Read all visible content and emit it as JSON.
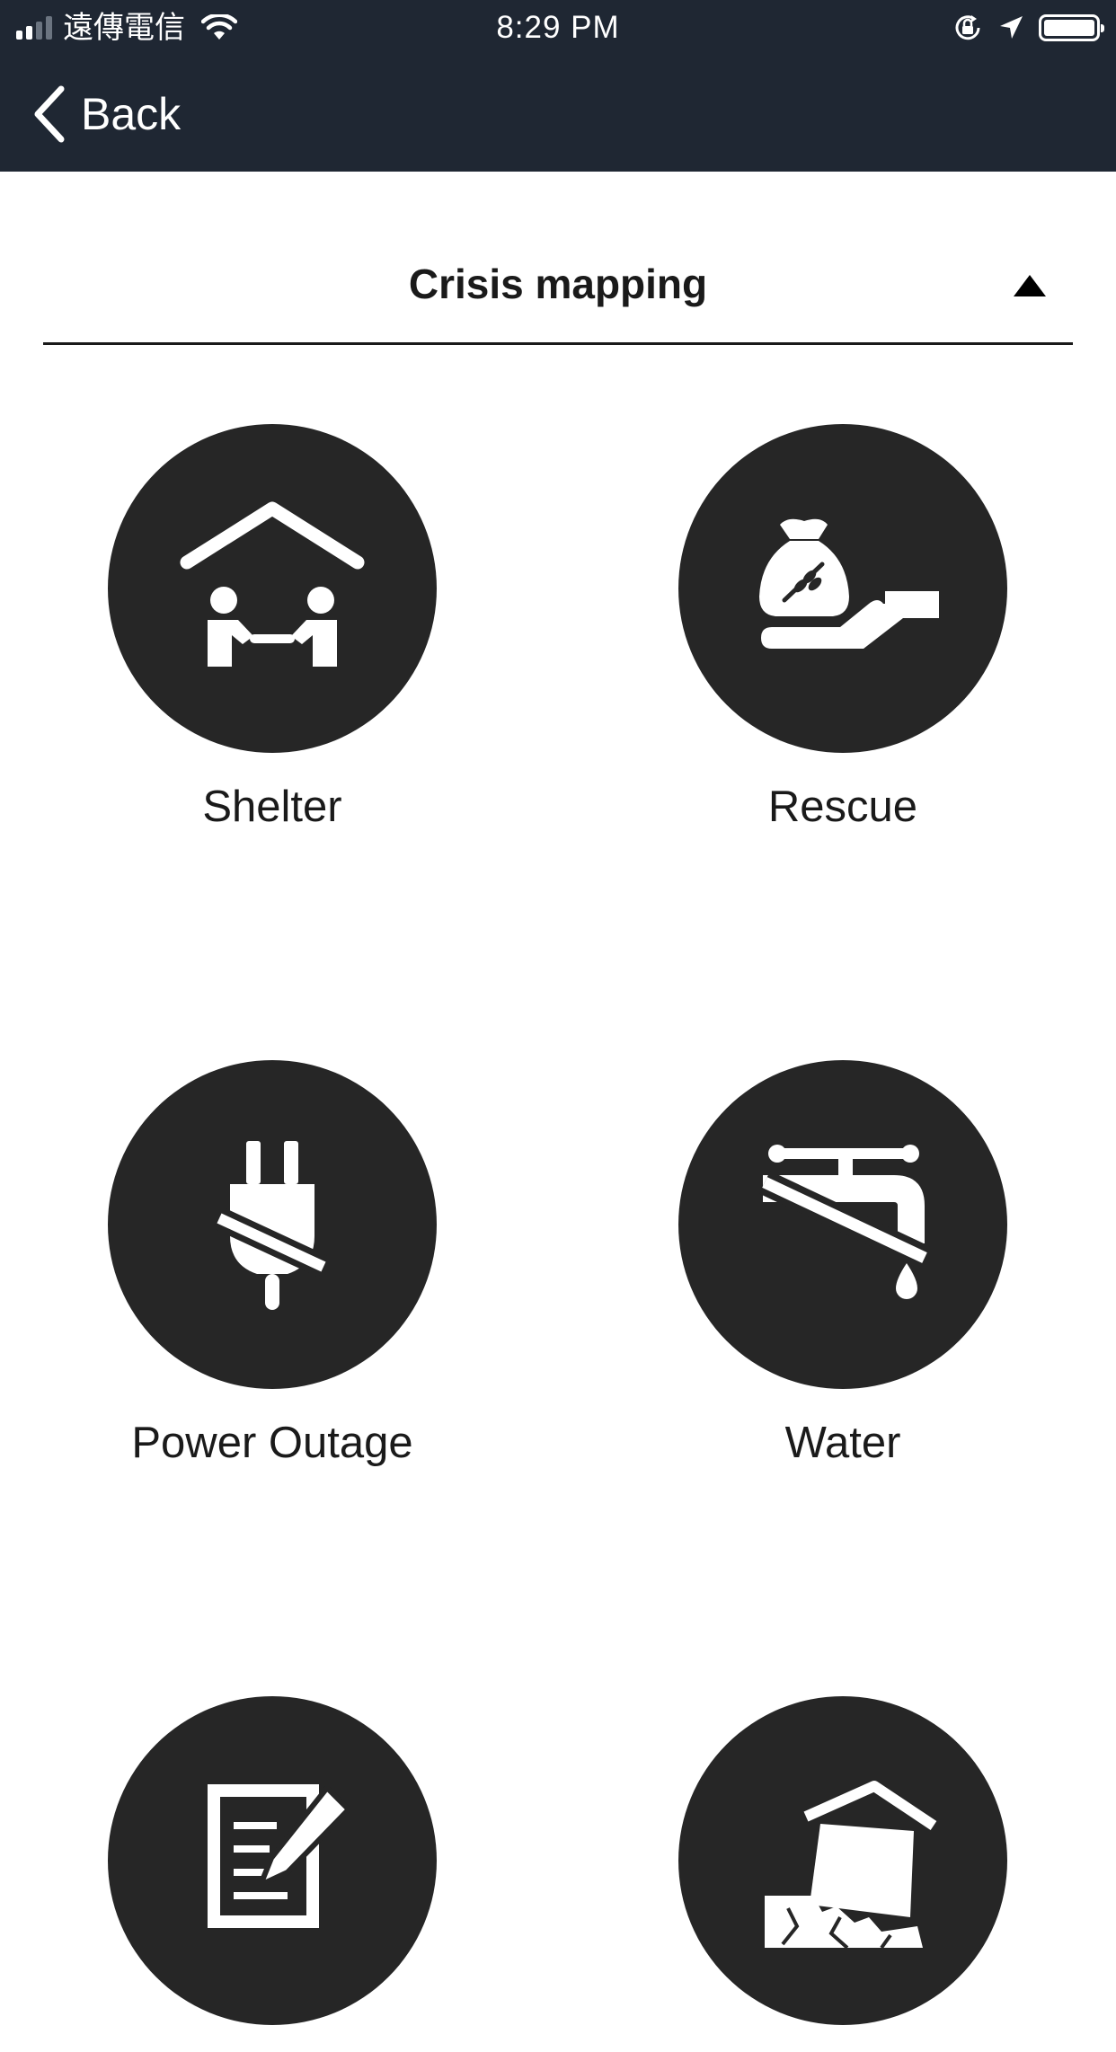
{
  "status_bar": {
    "carrier": "遠傳電信",
    "time": "8:29 PM",
    "signal_bars": 4,
    "signal_active": 2,
    "battery_level": 1.0,
    "icons": [
      "wifi-icon",
      "rotation-lock-icon",
      "location-arrow-icon",
      "battery-icon"
    ]
  },
  "nav": {
    "back_label": "Back",
    "back_icon": "chevron-left-icon"
  },
  "dropdown": {
    "title": "Crisis mapping",
    "expanded": true,
    "arrow_icon": "triangle-up-icon"
  },
  "categories": [
    {
      "label": "Shelter",
      "icon": "shelter-icon"
    },
    {
      "label": "Rescue",
      "icon": "food-aid-icon"
    },
    {
      "label": "Power Outage",
      "icon": "power-outage-icon"
    },
    {
      "label": "Water",
      "icon": "water-outage-icon"
    },
    {
      "label": "",
      "icon": "report-form-icon"
    },
    {
      "label": "",
      "icon": "collapsed-house-icon"
    }
  ],
  "colors": {
    "header_bg": "#1f2733",
    "circle_bg": "#262626",
    "text": "#1a1a1a"
  }
}
